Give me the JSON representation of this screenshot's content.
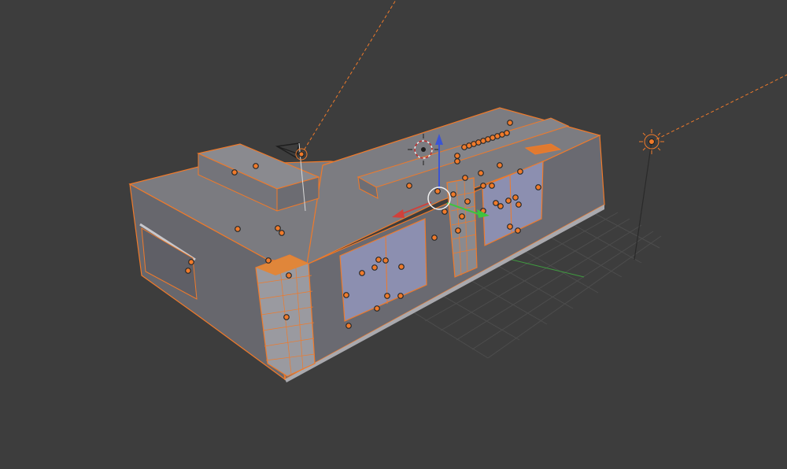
{
  "viewport": {
    "mode": "3D Viewport",
    "background_color": "#3d3d3d",
    "grid_color": "#4a4a4a",
    "selection_color": "#f07a2a",
    "axis_x_color": "#d0413b",
    "axis_y_color": "#3fc33f",
    "axis_z_color": "#3b55d4"
  },
  "scene": {
    "objects": [
      {
        "name": "building-mesh",
        "type": "mesh",
        "selected": true
      },
      {
        "name": "camera",
        "type": "camera",
        "selected": true
      },
      {
        "name": "sun-lamp",
        "type": "lamp",
        "selected": true
      },
      {
        "name": "point-lamp",
        "type": "lamp",
        "selected": true
      }
    ]
  },
  "icons": {
    "transform_gizmo": "translate-gizmo-icon",
    "cursor_3d": "3d-cursor-icon",
    "camera": "camera-icon",
    "lamp": "lamp-icon"
  }
}
